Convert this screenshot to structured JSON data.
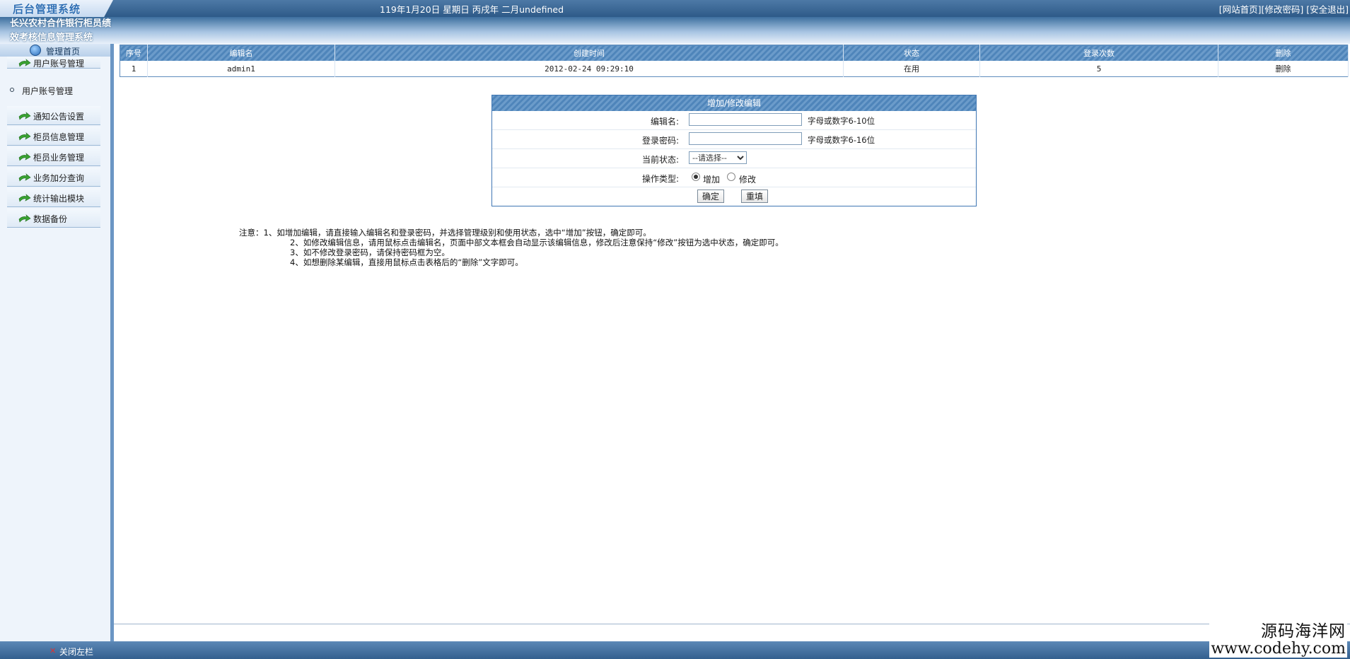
{
  "header": {
    "logo_text": "后台管理系统",
    "datetime": "119年1月20日 星期日 丙戌年 二月undefined",
    "links": [
      "[网站首页]",
      "[修改密码]",
      "[安全退出]"
    ],
    "system_title": "长兴农村合作银行柜员绩效考核信息管理系统"
  },
  "sidebar": {
    "home": "管理首页",
    "items": [
      "用户账号管理",
      "通知公告设置",
      "柜员信息管理",
      "柜员业务管理",
      "业务加分查询",
      "统计输出模块",
      "数据备份"
    ],
    "submenu": "用户账号管理",
    "colors": {
      "arrow": "#3aa332",
      "border": "#6b96c4"
    }
  },
  "table": {
    "headers": [
      "序号",
      "编辑名",
      "创建时间",
      "状态",
      "登录次数",
      "删除"
    ],
    "rows": [
      {
        "no": "1",
        "name": "admin1",
        "created": "2012-02-24 09:29:10",
        "status": "在用",
        "logins": "5",
        "delete": "删除"
      }
    ]
  },
  "form": {
    "title": "增加/修改编辑",
    "name_label": "编辑名:",
    "name_hint": "字母或数字6-10位",
    "password_label": "登录密码:",
    "password_hint": "字母或数字6-16位",
    "status_label": "当前状态:",
    "status_selected": "--请选择--",
    "optype_label": "操作类型:",
    "radio_add": "增加",
    "radio_edit": "修改",
    "selected": "增加",
    "ok_button": "确定",
    "reset_button": "重填"
  },
  "notes": {
    "line1": "注意：1、如增加编辑，请直接输入编辑名和登录密码，并选择管理级别和使用状态，选中“增加”按钮，确定即可。",
    "line2": "2、如修改编辑信息，请用鼠标点击编辑名，页面中部文本框会自动显示该编辑信息，修改后注意保持“修改”按钮为选中状态，确定即可。",
    "line3": "3、如不修改登录密码，请保持密码框为空。",
    "line4": "4、如想删除某编辑，直接用鼠标点击表格后的“删除”文字即可。"
  },
  "footer": {
    "close_sidebar": "关闭左栏",
    "watermark_cn": "源码海洋网",
    "watermark_url": "www.codehy.com"
  },
  "colors": {
    "header_blue": "#2e5a88",
    "table_header": "#5f8cbd"
  }
}
